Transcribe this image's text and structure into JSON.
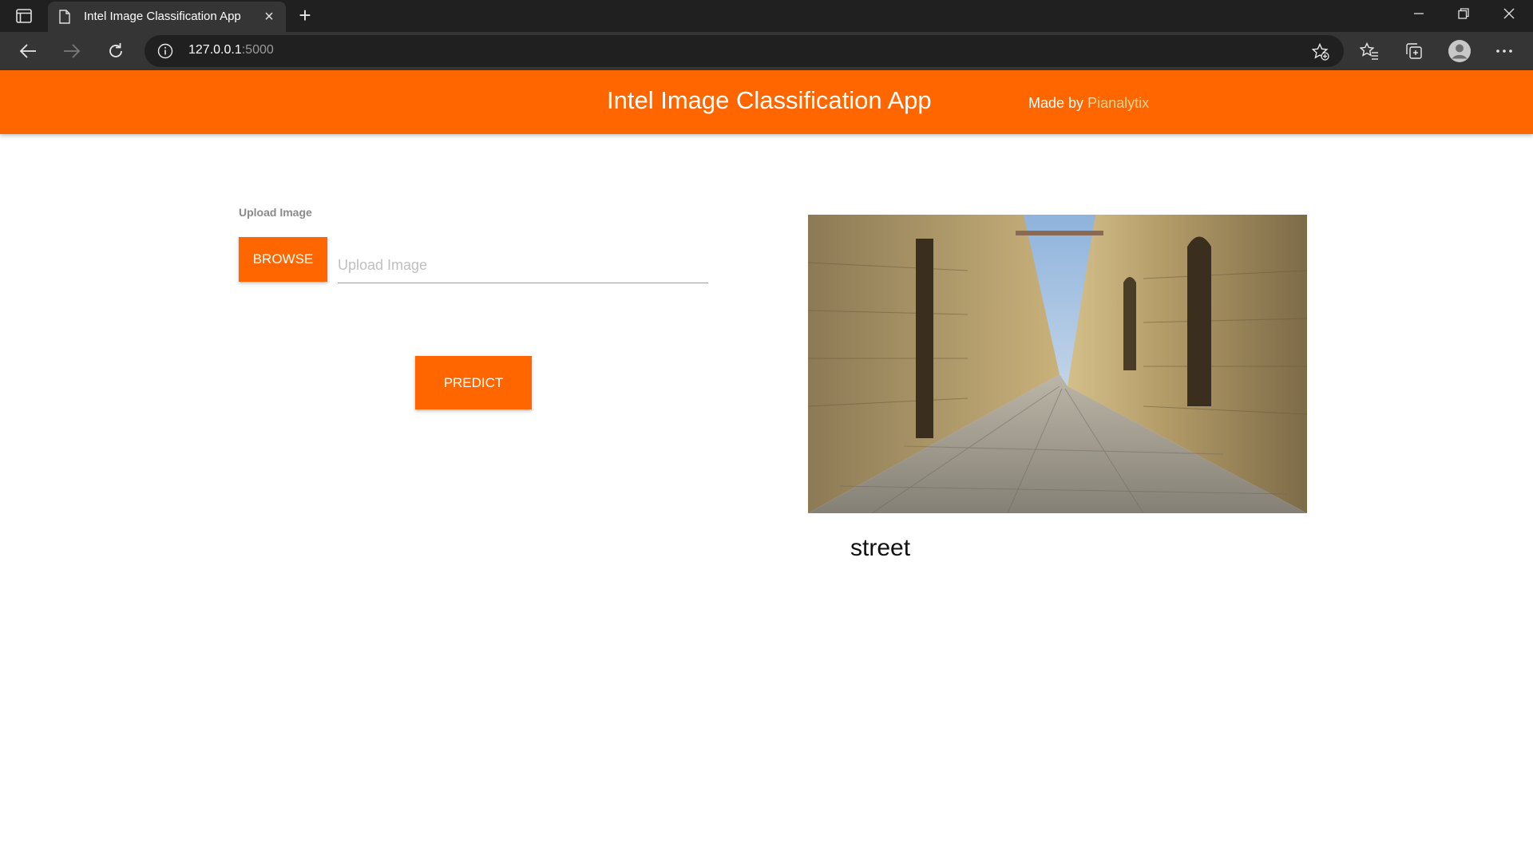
{
  "browser": {
    "tab": {
      "title": "Intel Image Classification App"
    },
    "address": {
      "host": "127.0.0.1",
      "port": ":5000"
    }
  },
  "app": {
    "title": "Intel Image Classification App",
    "made_by_prefix": "Made by ",
    "made_by_name": "Pianalytix",
    "accent_color": "#ff6600"
  },
  "form": {
    "upload_label": "Upload Image",
    "browse_label": "BROWSE",
    "upload_placeholder": "Upload Image",
    "predict_label": "PREDICT"
  },
  "result": {
    "prediction": "street"
  }
}
